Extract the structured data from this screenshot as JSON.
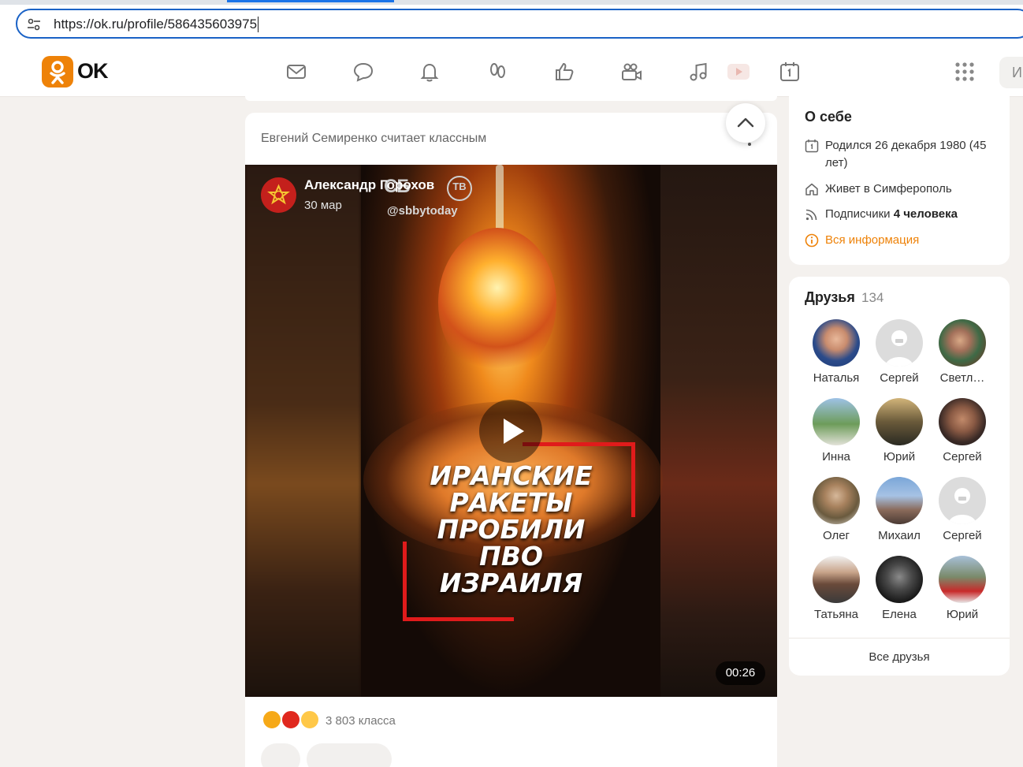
{
  "browser": {
    "url": "https://ok.ru/profile/586435603975"
  },
  "header": {
    "logo_text": "OK",
    "search_stub": "И",
    "nav_icons": [
      "mail-icon",
      "chat-icon",
      "bell-icon",
      "guests-icon",
      "like-icon",
      "camera-icon",
      "music-icon",
      "video-icon",
      "calendar-icon"
    ],
    "accent": "#ee8208"
  },
  "feed": {
    "post": {
      "context": "Евгений Семиренко считает классным",
      "author": "Александр Горохов",
      "date": "30 мар",
      "watermark_logo": "СБ",
      "watermark_tv": "ТВ",
      "watermark_handle": "@sbbytoday",
      "headline": "ИРАНСКИЕ\nРАКЕТЫ\nПРОБИЛИ\nПВО\nИЗРАИЛЯ",
      "duration": "00:26",
      "reactions_count": "3 803 класса"
    }
  },
  "sidebar": {
    "about": {
      "title": "О себе",
      "born": "Родился 26 декабря 1980 (45 лет)",
      "lives": "Живет в Симферополь",
      "subscribers_label": "Подписчики",
      "subscribers_value": "4 человека",
      "all_info": "Вся информация"
    },
    "friends": {
      "title": "Друзья",
      "count": "134",
      "items": [
        {
          "name": "Наталья"
        },
        {
          "name": "Сергей"
        },
        {
          "name": "Светл…"
        },
        {
          "name": "Инна"
        },
        {
          "name": "Юрий"
        },
        {
          "name": "Сергей"
        },
        {
          "name": "Олег"
        },
        {
          "name": "Михаил"
        },
        {
          "name": "Сергей"
        },
        {
          "name": "Татьяна"
        },
        {
          "name": "Елена"
        },
        {
          "name": "Юрий"
        }
      ],
      "all_label": "Все друзья"
    }
  }
}
